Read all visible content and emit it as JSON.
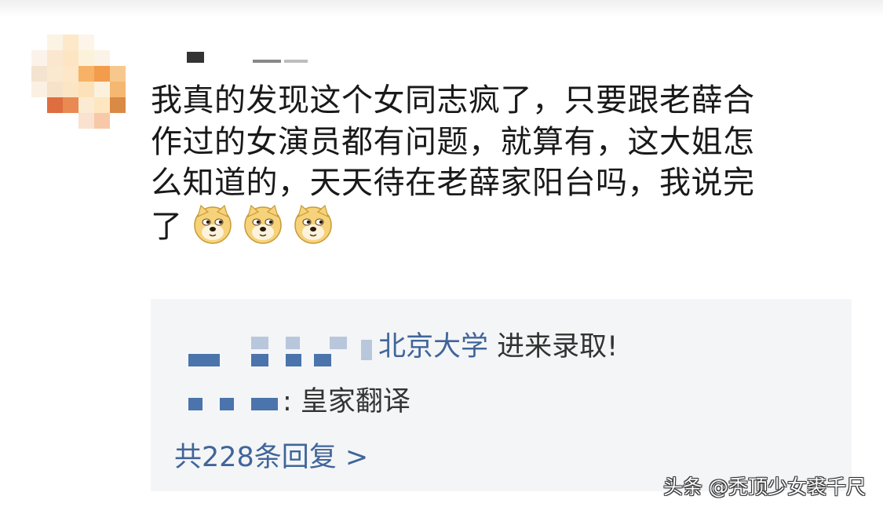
{
  "comment": {
    "lines": [
      "我真的发现这个女同志疯了，只要跟老薛合",
      "作过的女演员都有问题，就算有，这大姐怎",
      "么知道的，天天待在老薛家阳台吗，我说完",
      "了"
    ],
    "emoji": [
      "doge-icon",
      "doge-icon",
      "doge-icon"
    ]
  },
  "replies": [
    {
      "name_tail": "北京大学",
      "text": " 进来录取!"
    },
    {
      "name_tail": "",
      "text": ": 皇家翻译"
    }
  ],
  "more_replies_label": "共228条回复 >",
  "watermark": "头条 @秃顶少女裘千尺",
  "colors": {
    "link": "#406599",
    "text": "#191919",
    "reply_bg": "#f4f5f7"
  }
}
